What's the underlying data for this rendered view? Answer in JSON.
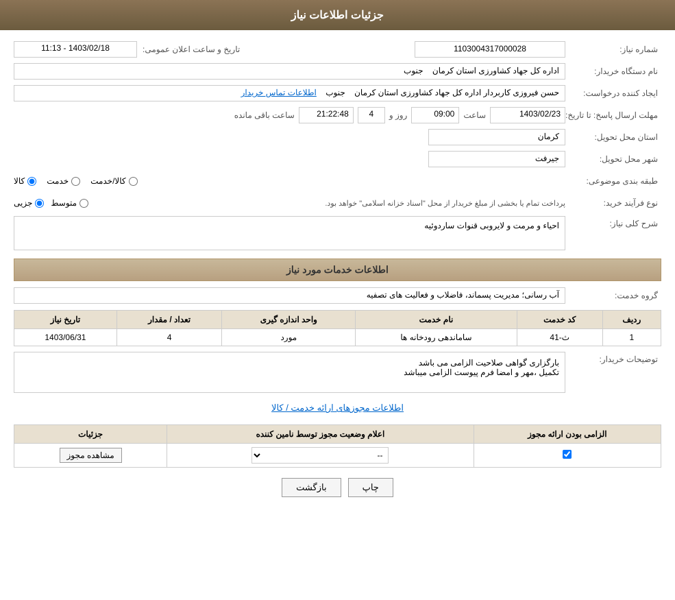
{
  "header": {
    "title": "جزئیات اطلاعات نیاز"
  },
  "labels": {
    "need_number": "شماره نیاز:",
    "buyer_org": "نام دستگاه خریدار:",
    "requester": "ایجاد کننده درخواست:",
    "response_deadline": "مهلت ارسال پاسخ: تا تاریخ:",
    "province": "استان محل تحویل:",
    "city": "شهر محل تحویل:",
    "category": "طبقه بندی موضوعی:",
    "purchase_type": "نوع فرآیند خرید:",
    "need_description": "شرح کلی نیاز:",
    "service_section_title": "اطلاعات خدمات مورد نیاز",
    "service_group": "گروه خدمت:",
    "row": "ردیف",
    "service_code": "کد خدمت",
    "service_name": "نام خدمت",
    "unit": "واحد اندازه گیری",
    "quantity": "تعداد / مقدار",
    "need_date": "تاریخ نیاز",
    "buyer_notes": "توضیحات خریدار:",
    "permissions_link": "اطلاعات مجوزهای ارائه خدمت / کالا",
    "license_required": "الزامی بودن ارائه مجوز",
    "supplier_status": "اعلام وضعیت مجوز توسط نامین کننده",
    "details_col": "جزئیات",
    "date_time_label": "تاریخ و ساعت اعلان عمومی:",
    "contact_info": "اطلاعات تماس خریدار"
  },
  "values": {
    "need_number": "1103004317000028",
    "buyer_org_name": "اداره کل جهاد کشاورزی استان کرمان",
    "buyer_org_region": "جنوب",
    "requester_name": "حسن فیروزی کاربردار اداره کل جهاد کشاورزی استان کرمان",
    "requester_region": "جنوب",
    "announce_date": "1403/02/18 - 11:13",
    "deadline_date": "1403/02/23",
    "deadline_time": "09:00",
    "deadline_days": "4",
    "deadline_clock": "21:22:48",
    "deadline_remaining": "ساعت باقی مانده",
    "province_value": "کرمان",
    "city_value": "جیرفت",
    "category_kala": "کالا",
    "category_khedmat": "خدمت",
    "category_kala_khedmat": "کالا/خدمت",
    "purchase_jozvi": "جزیی",
    "purchase_motavaset": "متوسط",
    "purchase_note": "پرداخت تمام یا بخشی از مبلغ خریدار از محل \"اسناد خزانه اسلامی\" خواهد بود.",
    "description_text": "احیاء و مرمت و لایروبی قنوات ساردوئیه",
    "service_group_value": "آب رسانی؛ مدیریت پسماند، فاضلاب و فعالیت های تصفیه",
    "table": {
      "rows": [
        {
          "row_num": "1",
          "service_code": "ث-41",
          "service_name": "ساماندهی رودخانه ها",
          "unit": "مورد",
          "quantity": "4",
          "need_date": "1403/06/31"
        }
      ]
    },
    "buyer_notes_text": "بارگزاری گواهی صلاحیت الزامی می باشد\nتکمیل ،مهر و امضا فرم پیوست الزامی میباشد",
    "permissions_table": {
      "rows": [
        {
          "license_required_checked": true,
          "supplier_status": "--",
          "view_btn_label": "مشاهده مجوز"
        }
      ]
    }
  },
  "buttons": {
    "print": "چاپ",
    "back": "بازگشت",
    "view_license": "مشاهده مجوز"
  }
}
